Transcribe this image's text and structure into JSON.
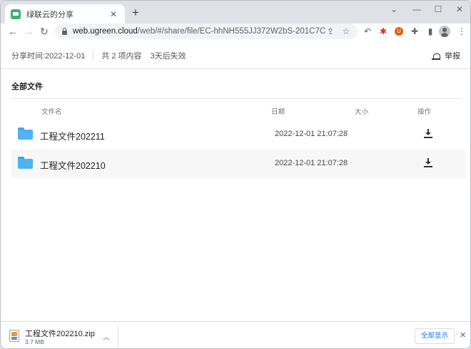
{
  "browser": {
    "tab_title": "绿联云的分享",
    "tab_close": "✕",
    "new_tab": "+",
    "url_host": "web.ugreen.cloud",
    "url_path": "/web/#/share/file/EC-hhNH555JJ372W2bS-201C7C",
    "window_controls": {
      "minimize": "—",
      "maximize": "☐",
      "close": "✕",
      "menu": "⌄"
    }
  },
  "share_info": {
    "share_time": "分享时间:2022-12-01",
    "item_count": "共 2 项内容",
    "expiry": "3天后失效",
    "report_label": "举报"
  },
  "section_title": "全部文件",
  "table": {
    "headers": {
      "name": "文件名",
      "date": "日期",
      "size": "大小",
      "action": "操作"
    },
    "rows": [
      {
        "name": "工程文件202211",
        "date": "2022-12-01 21:07:28",
        "size": "",
        "type": "folder"
      },
      {
        "name": "工程文件202210",
        "date": "2022-12-01 21:07:28",
        "size": "",
        "type": "folder"
      }
    ]
  },
  "download_bar": {
    "file_name": "工程文件202210.zip",
    "file_size": "3.7 MB",
    "show_all_label": "全部显示",
    "close": "✕"
  },
  "colors": {
    "folder": "#50b3f2",
    "favicon": "#3cb371",
    "link": "#1a73e8"
  }
}
